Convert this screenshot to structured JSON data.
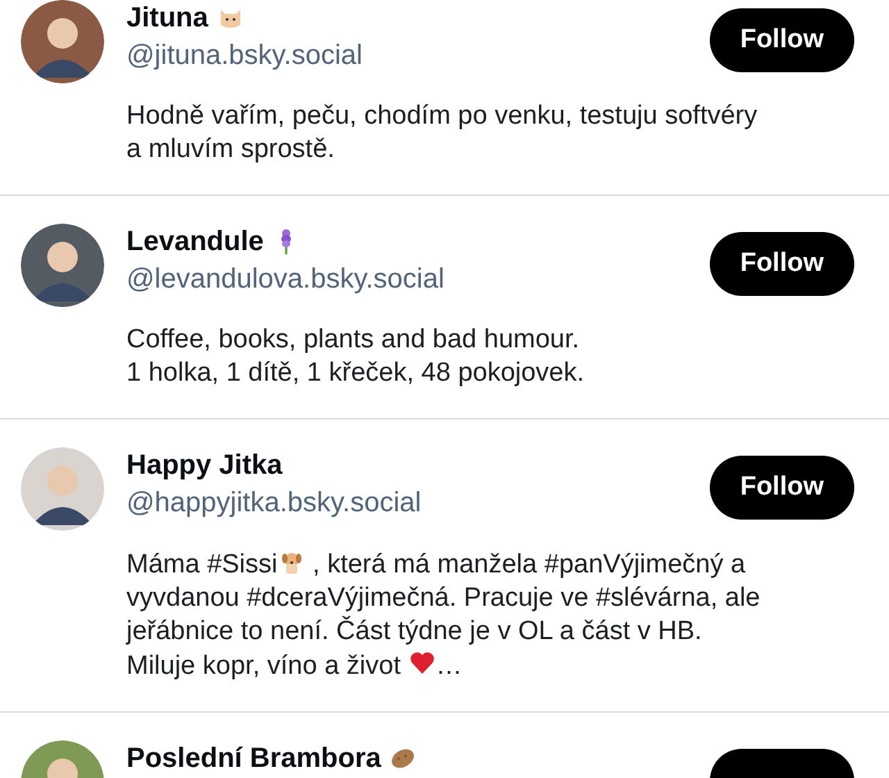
{
  "profiles": [
    {
      "name": "Jituna",
      "name_emoji": {
        "kind": "cat"
      },
      "handle": "@jituna.bsky.social",
      "button": "Follow",
      "bio": [
        {
          "kind": "text",
          "text": "Hodně vařím, peču, chodím po venku, testuju softvéry a mluvím sprostě."
        }
      ]
    },
    {
      "name": "Levandule",
      "name_emoji": {
        "kind": "flower"
      },
      "handle": "@levandulova.bsky.social",
      "button": "Follow",
      "bio": [
        {
          "kind": "text",
          "text": "Coffee, books, plants and bad humour."
        },
        {
          "kind": "break"
        },
        {
          "kind": "text",
          "text": "1 holka, 1 dítě, 1 křeček, 48 pokojovek."
        }
      ]
    },
    {
      "name": "Happy Jitka",
      "handle": "@happyjitka.bsky.social",
      "button": "Follow",
      "bio": [
        {
          "kind": "text",
          "text": "Máma #Sissi"
        },
        {
          "kind": "dog"
        },
        {
          "kind": "text",
          "text": " , která má manžela #panVýjimečný a vyvdanou #dceraVýjimečná. Pracuje ve #slévárna, ale jeřábnice to není. Část týdne je v OL a část v HB. Miluje kopr, víno a život "
        },
        {
          "kind": "heart"
        },
        {
          "kind": "text",
          "text": "…"
        }
      ]
    },
    {
      "name": "Poslední Brambora",
      "name_emoji": {
        "kind": "potato"
      },
      "button_cut": true
    }
  ]
}
